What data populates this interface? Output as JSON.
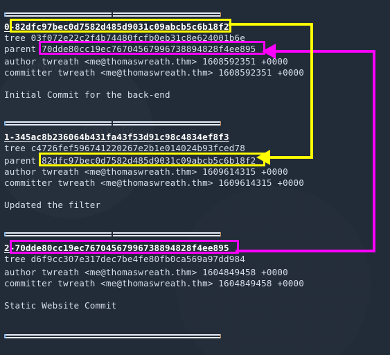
{
  "terminal": {
    "separator_char": "=",
    "commits": [
      {
        "index_label": "0-",
        "hash": "82dfc97bec0d7582d485d9031c09abcb5c6b18f2",
        "header": "0-82dfc97bec0d7582d485d9031c09abcb5c6b18f2",
        "tree_line": "tree 03f072e22c2f4b74480fcfb0eb31c8e624001b6e",
        "tree_key": "tree",
        "tree_hash": "03f072e22c2f4b74480fcfb0eb31c8e624001b6e",
        "parent_key": "parent",
        "parent_hash": "70dde80cc19ec76704567996738894828f4ee895",
        "parent_line": "parent 70dde80cc19ec76704567996738894828f4ee895",
        "author_line": "author twreath <me@thomaswreath.thm> 1608592351 +0000",
        "committer_line": "committer twreath <me@thomaswreath.thm> 1608592351 +0000",
        "message": "Initial Commit for the back-end"
      },
      {
        "index_label": "1-",
        "hash": "345ac8b236064b431fa43f53d91c98c4834ef8f3",
        "header": "1-345ac8b236064b431fa43f53d91c98c4834ef8f3",
        "tree_line": "tree c4726fef596741220267e2b1e014024b93fced78",
        "tree_key": "tree",
        "tree_hash": "c4726fef596741220267e2b1e014024b93fced78",
        "parent_key": "parent",
        "parent_hash": "82dfc97bec0d7582d485d9031c09abcb5c6b18f2",
        "parent_line": "parent 82dfc97bec0d7582d485d9031c09abcb5c6b18f2",
        "author_line": "author twreath <me@thomaswreath.thm> 1609614315 +0000",
        "committer_line": "committer twreath <me@thomaswreath.thm> 1609614315 +0000",
        "message": "Updated the filter"
      },
      {
        "index_label": "2-",
        "hash": "70dde80cc19ec76704567996738894828f4ee895",
        "header": "2-70dde80cc19ec76704567996738894828f4ee895",
        "tree_line": "tree d6f9cc307e317dec7be4fe80fb0ca569a97dd984",
        "tree_key": "tree",
        "tree_hash": "d6f9cc307e317dec7be4fe80fb0ca569a97dd984",
        "parent_key": "",
        "parent_hash": "",
        "parent_line": "",
        "author_line": "author twreath <me@thomaswreath.thm> 1604849458 +0000",
        "committer_line": "committer twreath <me@thomaswreath.thm> 1604849458 +0000",
        "message": "Static Website Commit"
      }
    ]
  },
  "annotations": {
    "colors": {
      "highlight_yellow": "#ffff00",
      "highlight_magenta": "#ff00ff",
      "terminal_background": "#222b38",
      "terminal_foreground": "#d6deeb"
    },
    "yellow_link": {
      "from_label": "commit-0-hash",
      "to_label": "commit-1-parent-hash",
      "description": "yellow box around commit 0 hash connects to yellow box around commit 1 parent"
    },
    "magenta_link": {
      "from_label": "commit-2-hash",
      "to_label": "commit-0-parent-hash",
      "description": "magenta box around commit 2 hash connects to magenta box around commit 0 parent"
    }
  }
}
